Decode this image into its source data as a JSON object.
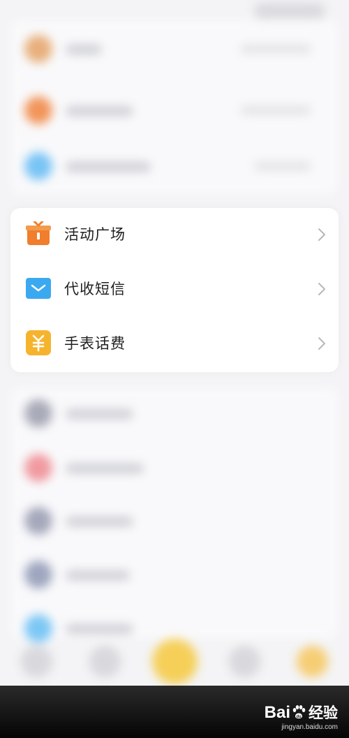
{
  "menu": {
    "items": [
      {
        "id": "activity-plaza",
        "label": "活动广场",
        "icon": "gift-box-icon",
        "color": "#f07e2c"
      },
      {
        "id": "proxy-sms",
        "label": "代收短信",
        "icon": "envelope-icon",
        "color": "#3ba9f0"
      },
      {
        "id": "watch-phone-bill",
        "label": "手表话费",
        "icon": "yuan-icon",
        "color": "#f6b42e"
      }
    ]
  },
  "watermark": {
    "brand_left": "Bai",
    "brand_right": "经验",
    "url": "jingyan.baidu.com"
  },
  "colors": {
    "background": "#f4f4f6",
    "card": "#ffffff",
    "text": "#1f1f1f",
    "chevron": "#b8b8bc"
  }
}
